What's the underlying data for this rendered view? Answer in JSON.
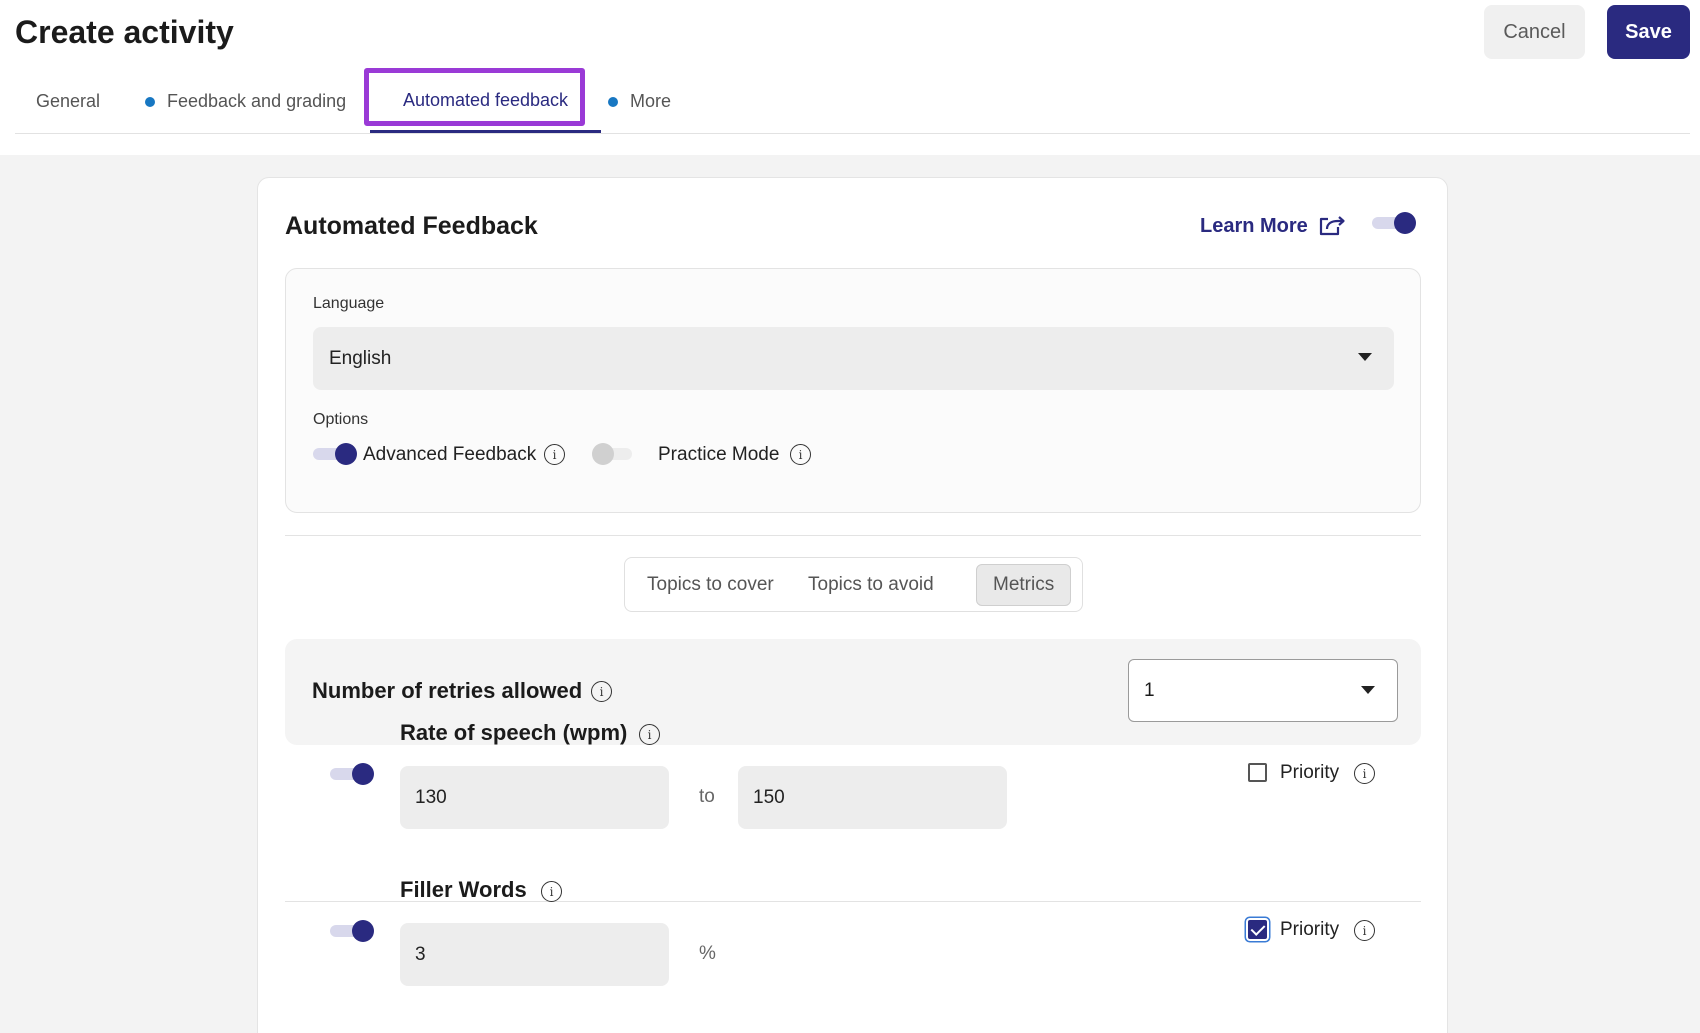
{
  "header": {
    "title": "Create activity",
    "cancel_label": "Cancel",
    "save_label": "Save",
    "tabs": [
      {
        "label": "General"
      },
      {
        "label": "Feedback and grading"
      },
      {
        "label": "Automated feedback"
      },
      {
        "label": "More"
      }
    ]
  },
  "card": {
    "title": "Automated Feedback",
    "learn_more": "Learn More",
    "enabled": true,
    "language": {
      "label": "Language",
      "value": "English"
    },
    "options": {
      "label": "Options",
      "advanced_feedback": {
        "label": "Advanced Feedback",
        "on": true
      },
      "practice_mode": {
        "label": "Practice Mode",
        "on": false
      }
    },
    "segments": [
      {
        "label": "Topics to cover"
      },
      {
        "label": "Topics to avoid"
      },
      {
        "label": "Metrics"
      }
    ],
    "retries": {
      "label": "Number of retries allowed",
      "value": "1"
    },
    "rate_of_speech": {
      "title": "Rate of speech (wpm)",
      "min": "130",
      "sep": "to",
      "max": "150",
      "priority_label": "Priority",
      "priority": false
    },
    "filler_words": {
      "title": "Filler Words",
      "value": "3",
      "unit": "%",
      "priority_label": "Priority",
      "priority": true
    }
  },
  "colors": {
    "accent": "#2a2a80",
    "highlight": "#9a3ad6",
    "dot": "#1777c2"
  }
}
